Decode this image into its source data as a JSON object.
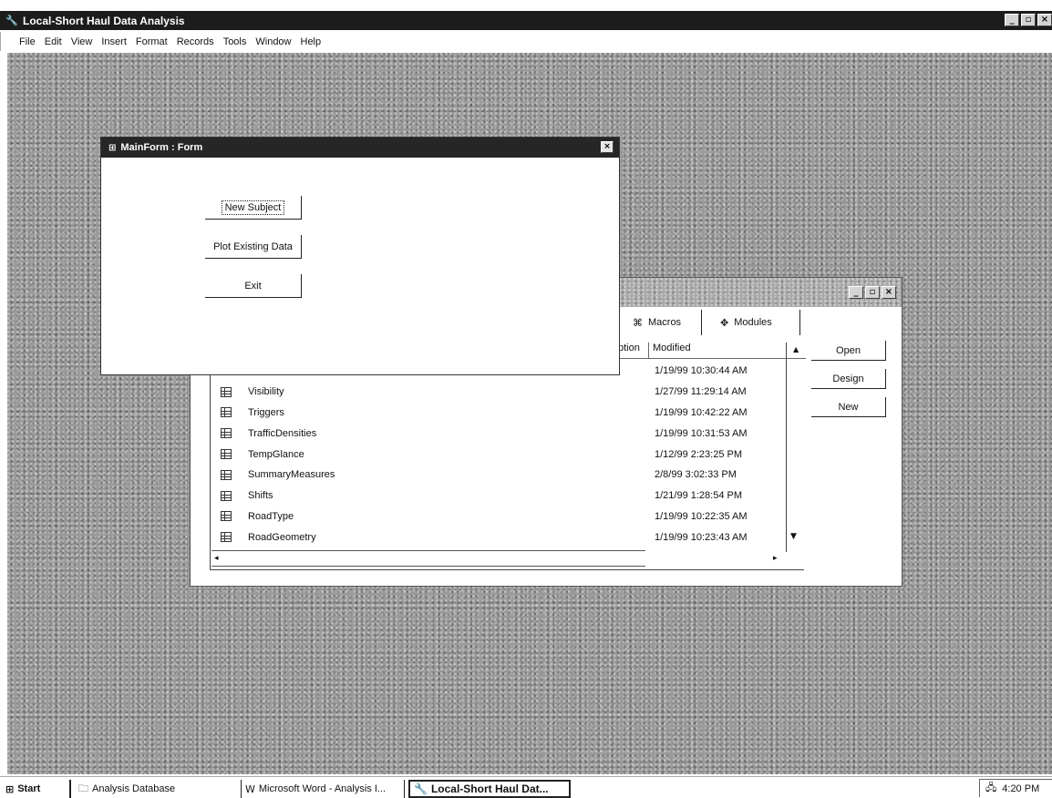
{
  "app": {
    "title": "Local-Short Haul Data Analysis",
    "buttons": {
      "minimize": "_",
      "maximize": "▫",
      "close": "×"
    }
  },
  "menubar": [
    {
      "label": "File"
    },
    {
      "label": "Edit"
    },
    {
      "label": "View"
    },
    {
      "label": "Insert"
    },
    {
      "label": "Format"
    },
    {
      "label": "Records"
    },
    {
      "label": "Tools"
    },
    {
      "label": "Window"
    },
    {
      "label": "Help"
    }
  ],
  "main_form": {
    "title": "MainForm : Form",
    "buttons": {
      "new_subject": "New Subject",
      "plot_existing": "Plot Existing Data",
      "exit": "Exit"
    }
  },
  "database_window": {
    "tabs": {
      "macros": "Macros",
      "modules": "Modules"
    },
    "columns": {
      "description": "ption",
      "modified": "Modified"
    },
    "first_row_date": "1/19/99 10:30:44 AM",
    "rows": [
      {
        "name": "Visibility",
        "modified": "1/27/99 11:29:14 AM"
      },
      {
        "name": "Triggers",
        "modified": "1/19/99 10:42:22 AM"
      },
      {
        "name": "TrafficDensities",
        "modified": "1/19/99 10:31:53 AM"
      },
      {
        "name": "TempGlance",
        "modified": "1/12/99 2:23:25 PM"
      },
      {
        "name": "SummaryMeasures",
        "modified": "2/8/99 3:02:33 PM"
      },
      {
        "name": "Shifts",
        "modified": "1/21/99 1:28:54 PM"
      },
      {
        "name": "RoadType",
        "modified": "1/19/99 10:22:35 AM"
      },
      {
        "name": "RoadGeometry",
        "modified": "1/19/99 10:23:43 AM"
      }
    ],
    "side_buttons": {
      "open": "Open",
      "design": "Design",
      "new": "New"
    }
  },
  "taskbar": {
    "start": "Start",
    "items": {
      "analysis_db": "Analysis Database",
      "word": "Microsoft Word - Analysis I...",
      "local": "Local-Short Haul Dat..."
    },
    "clock": "4:20 PM"
  }
}
